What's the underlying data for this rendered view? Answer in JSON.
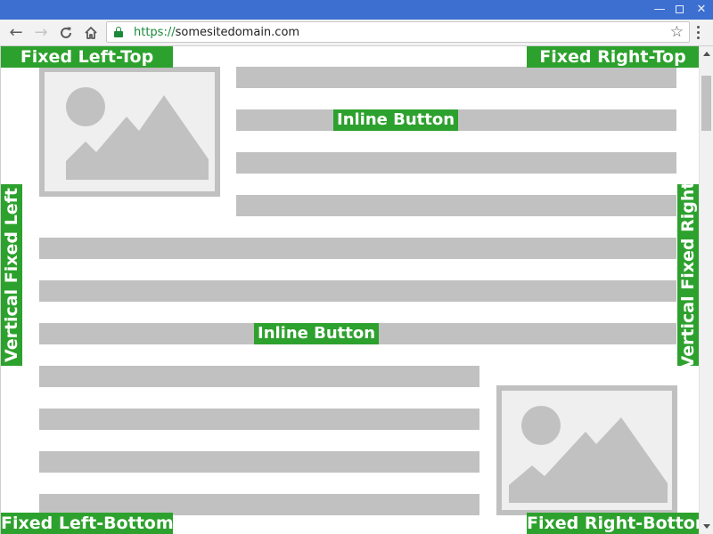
{
  "window": {
    "minimize_glyph": "—",
    "close_glyph": "✕"
  },
  "toolbar": {
    "back_icon": "arrow-left-icon",
    "forward_icon": "arrow-right-icon",
    "reload_icon": "reload-icon",
    "home_icon": "home-icon",
    "back_glyph": "←",
    "forward_glyph": "→",
    "star_glyph": "☆"
  },
  "address_bar": {
    "scheme": "https://",
    "host": "somesitedomain.com",
    "secure": true
  },
  "page": {
    "inline_button_1": "Inline Button",
    "inline_button_2": "Inline Button",
    "fixed_left_top": "Fixed Left-Top",
    "fixed_right_top": "Fixed Right-Top",
    "fixed_left_bottom": "Fixed Left-Bottom",
    "fixed_right_bottom": "Fixed Right-Bottom",
    "vertical_fixed_left": "Vertical Fixed Left",
    "vertical_fixed_right": "Vertical Fixed Right",
    "image_icon": "image-placeholder-icon"
  },
  "colors": {
    "titlebar": "#3c6fd0",
    "accent_green": "#2da12d",
    "placeholder_gray": "#c1c1c1",
    "secure_green": "#1a8a3a"
  }
}
